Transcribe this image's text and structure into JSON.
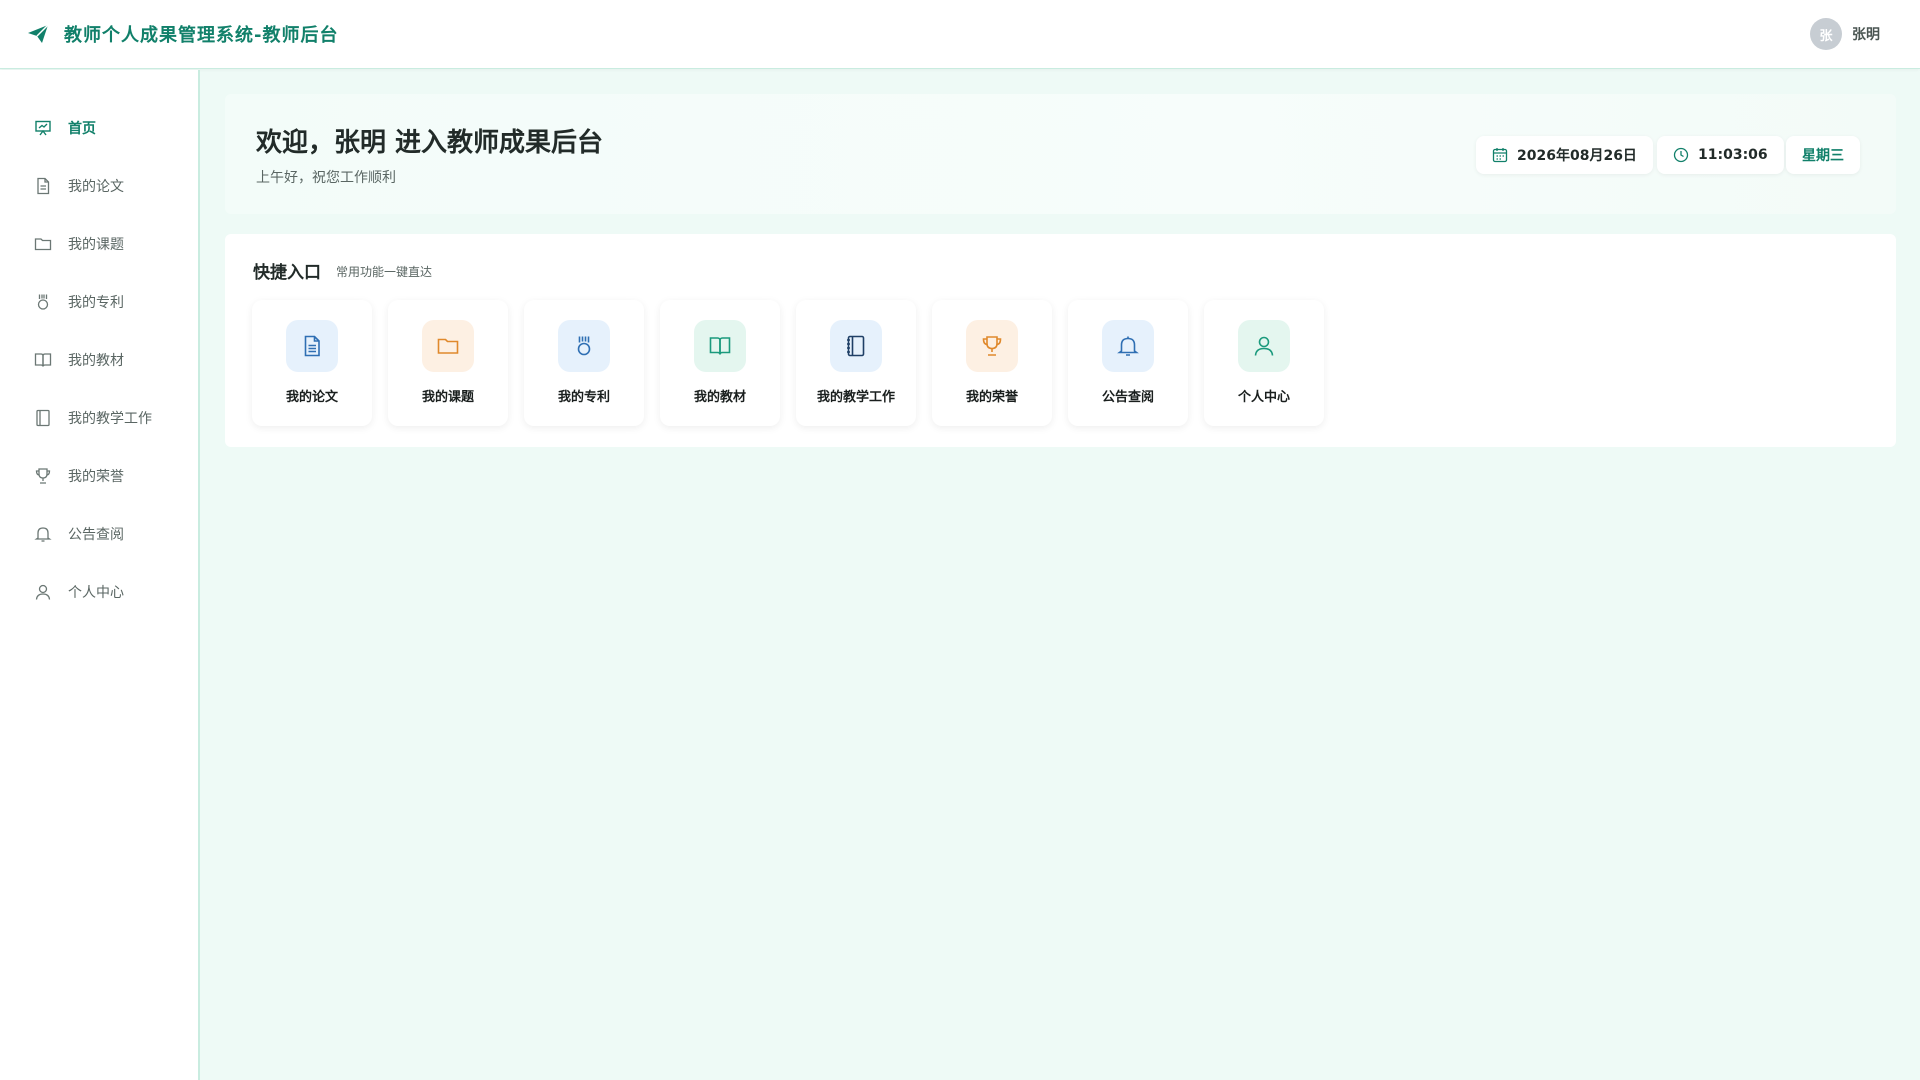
{
  "header": {
    "title": "教师个人成果管理系统-教师后台",
    "icon": "paper-plane-icon",
    "user": {
      "avatar_text": "张",
      "name": "张明"
    }
  },
  "sidebar": {
    "items": [
      {
        "label": "首页",
        "icon": "presentation-icon",
        "active": true
      },
      {
        "label": "我的论文",
        "icon": "document-icon"
      },
      {
        "label": "我的课题",
        "icon": "folder-icon"
      },
      {
        "label": "我的专利",
        "icon": "medal-icon"
      },
      {
        "label": "我的教材",
        "icon": "book-open-icon"
      },
      {
        "label": "我的教学工作",
        "icon": "notebook-icon"
      },
      {
        "label": "我的荣誉",
        "icon": "trophy-icon"
      },
      {
        "label": "公告查阅",
        "icon": "bell-icon"
      },
      {
        "label": "个人中心",
        "icon": "user-icon"
      }
    ]
  },
  "welcome": {
    "title": "欢迎，张明 进入教师成果后台",
    "subtitle": "上午好，祝您工作顺利",
    "date": "2026年08月26日",
    "time": "11:03:06",
    "weekday": "星期三"
  },
  "quick": {
    "title": "快捷入口",
    "subtitle": "常用功能一键直达",
    "tiles": [
      {
        "label": "我的论文",
        "icon": "document-icon",
        "tone": "blue"
      },
      {
        "label": "我的课题",
        "icon": "folder-icon",
        "tone": "orange"
      },
      {
        "label": "我的专利",
        "icon": "medal-icon",
        "tone": "blue"
      },
      {
        "label": "我的教材",
        "icon": "book-open-icon",
        "tone": "green"
      },
      {
        "label": "我的教学工作",
        "icon": "notebook-icon",
        "tone": "blue"
      },
      {
        "label": "我的荣誉",
        "icon": "trophy-icon",
        "tone": "orange"
      },
      {
        "label": "公告查阅",
        "icon": "bell-icon",
        "tone": "blue"
      },
      {
        "label": "个人中心",
        "icon": "user-icon",
        "tone": "green"
      }
    ]
  },
  "colors": {
    "brand": "#11806a",
    "page_bg": "#eefaf6",
    "icon_blue": "#2f6fb3",
    "icon_orange": "#e0892c",
    "icon_green": "#1b9a7d"
  }
}
